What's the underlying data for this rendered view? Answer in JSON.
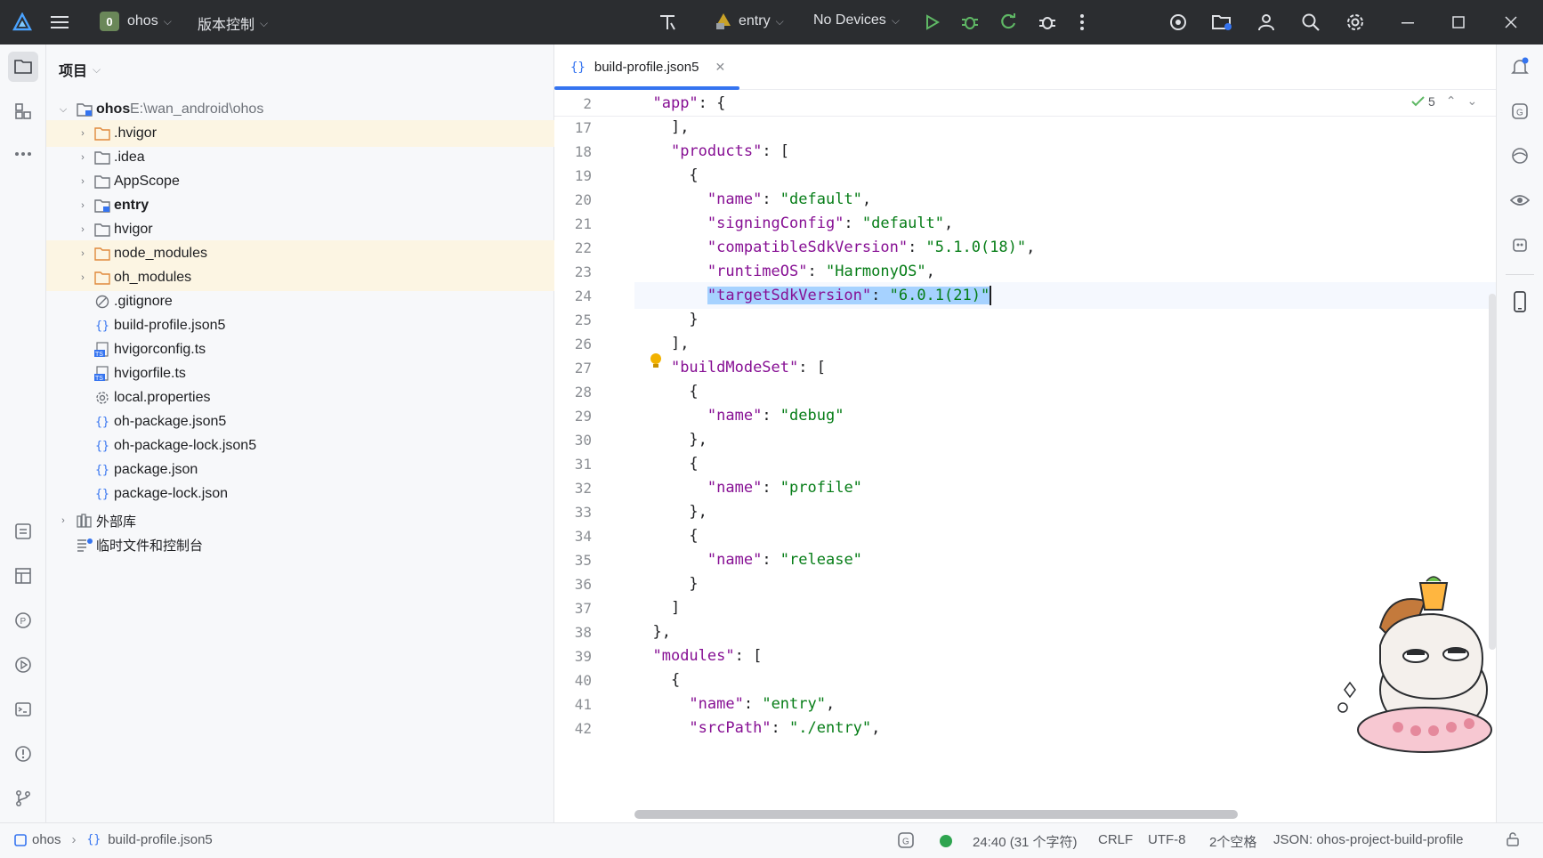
{
  "titlebar": {
    "project_badge": "0",
    "project_name": "ohos",
    "vcs_label": "版本控制",
    "module_name": "entry",
    "device_label": "No Devices"
  },
  "sidebar_panel": {
    "title": "项目"
  },
  "tree": {
    "root_name": "ohos",
    "root_path": "E:\\wan_android\\ohos",
    "items": [
      {
        "label": ".hvigor",
        "icon": "folder-icon"
      },
      {
        "label": ".idea",
        "icon": "folder-icon"
      },
      {
        "label": "AppScope",
        "icon": "folder-icon"
      },
      {
        "label": "entry",
        "icon": "module-folder-icon"
      },
      {
        "label": "hvigor",
        "icon": "folder-icon"
      },
      {
        "label": "node_modules",
        "icon": "folder-icon"
      },
      {
        "label": "oh_modules",
        "icon": "folder-icon"
      },
      {
        "label": ".gitignore",
        "icon": "ignore-file-icon"
      },
      {
        "label": "build-profile.json5",
        "icon": "json-icon"
      },
      {
        "label": "hvigorconfig.ts",
        "icon": "ts-file-icon"
      },
      {
        "label": "hvigorfile.ts",
        "icon": "ts-file-icon"
      },
      {
        "label": "local.properties",
        "icon": "properties-gear-icon"
      },
      {
        "label": "oh-package.json5",
        "icon": "json-icon"
      },
      {
        "label": "oh-package-lock.json5",
        "icon": "json-icon"
      },
      {
        "label": "package.json",
        "icon": "json-icon"
      },
      {
        "label": "package-lock.json",
        "icon": "json-icon"
      }
    ],
    "external_libs": "外部库",
    "scratches": "临时文件和控制台"
  },
  "editor": {
    "tab_label": "build-profile.json5",
    "inspection_count": "5",
    "sticky_line": {
      "num": "2",
      "key": "\"app\"",
      "rest": ": {"
    },
    "lines": [
      {
        "num": "17",
        "indent": "    ",
        "parts": [
          {
            "t": "p",
            "v": "],"
          }
        ]
      },
      {
        "num": "18",
        "indent": "    ",
        "parts": [
          {
            "t": "k",
            "v": "\"products\""
          },
          {
            "t": "p",
            "v": ": ["
          }
        ]
      },
      {
        "num": "19",
        "indent": "      ",
        "parts": [
          {
            "t": "p",
            "v": "{"
          }
        ]
      },
      {
        "num": "20",
        "indent": "        ",
        "parts": [
          {
            "t": "k",
            "v": "\"name\""
          },
          {
            "t": "p",
            "v": ": "
          },
          {
            "t": "s",
            "v": "\"default\""
          },
          {
            "t": "p",
            "v": ","
          }
        ]
      },
      {
        "num": "21",
        "indent": "        ",
        "parts": [
          {
            "t": "k",
            "v": "\"signingConfig\""
          },
          {
            "t": "p",
            "v": ": "
          },
          {
            "t": "s",
            "v": "\"default\""
          },
          {
            "t": "p",
            "v": ","
          }
        ]
      },
      {
        "num": "22",
        "indent": "        ",
        "parts": [
          {
            "t": "k",
            "v": "\"compatibleSdkVersion\""
          },
          {
            "t": "p",
            "v": ": "
          },
          {
            "t": "s",
            "v": "\"5.1.0(18)\""
          },
          {
            "t": "p",
            "v": ","
          }
        ]
      },
      {
        "num": "23",
        "indent": "        ",
        "parts": [
          {
            "t": "k",
            "v": "\"runtimeOS\""
          },
          {
            "t": "p",
            "v": ": "
          },
          {
            "t": "s",
            "v": "\"HarmonyOS\""
          },
          {
            "t": "p",
            "v": ","
          }
        ]
      },
      {
        "num": "24",
        "indent": "        ",
        "selected": true,
        "parts": [
          {
            "t": "k",
            "v": "\"targetSdkVersion\""
          },
          {
            "t": "p",
            "v": ": "
          },
          {
            "t": "s",
            "v": "\"6.0.1(21)\""
          }
        ]
      },
      {
        "num": "25",
        "indent": "      ",
        "parts": [
          {
            "t": "p",
            "v": "}"
          }
        ]
      },
      {
        "num": "26",
        "indent": "    ",
        "parts": [
          {
            "t": "p",
            "v": "],"
          }
        ]
      },
      {
        "num": "27",
        "indent": "    ",
        "parts": [
          {
            "t": "k",
            "v": "\"buildModeSet\""
          },
          {
            "t": "p",
            "v": ": ["
          }
        ]
      },
      {
        "num": "28",
        "indent": "      ",
        "parts": [
          {
            "t": "p",
            "v": "{"
          }
        ]
      },
      {
        "num": "29",
        "indent": "        ",
        "parts": [
          {
            "t": "k",
            "v": "\"name\""
          },
          {
            "t": "p",
            "v": ": "
          },
          {
            "t": "s",
            "v": "\"debug\""
          }
        ]
      },
      {
        "num": "30",
        "indent": "      ",
        "parts": [
          {
            "t": "p",
            "v": "},"
          }
        ]
      },
      {
        "num": "31",
        "indent": "      ",
        "parts": [
          {
            "t": "p",
            "v": "{"
          }
        ]
      },
      {
        "num": "32",
        "indent": "        ",
        "parts": [
          {
            "t": "k",
            "v": "\"name\""
          },
          {
            "t": "p",
            "v": ": "
          },
          {
            "t": "s",
            "v": "\"profile\""
          }
        ]
      },
      {
        "num": "33",
        "indent": "      ",
        "parts": [
          {
            "t": "p",
            "v": "},"
          }
        ]
      },
      {
        "num": "34",
        "indent": "      ",
        "parts": [
          {
            "t": "p",
            "v": "{"
          }
        ]
      },
      {
        "num": "35",
        "indent": "        ",
        "parts": [
          {
            "t": "k",
            "v": "\"name\""
          },
          {
            "t": "p",
            "v": ": "
          },
          {
            "t": "s",
            "v": "\"release\""
          }
        ]
      },
      {
        "num": "36",
        "indent": "      ",
        "parts": [
          {
            "t": "p",
            "v": "}"
          }
        ]
      },
      {
        "num": "37",
        "indent": "    ",
        "parts": [
          {
            "t": "p",
            "v": "]"
          }
        ]
      },
      {
        "num": "38",
        "indent": "  ",
        "parts": [
          {
            "t": "p",
            "v": "},"
          }
        ]
      },
      {
        "num": "39",
        "indent": "  ",
        "parts": [
          {
            "t": "k",
            "v": "\"modules\""
          },
          {
            "t": "p",
            "v": ": ["
          }
        ]
      },
      {
        "num": "40",
        "indent": "    ",
        "parts": [
          {
            "t": "p",
            "v": "{"
          }
        ]
      },
      {
        "num": "41",
        "indent": "      ",
        "parts": [
          {
            "t": "k",
            "v": "\"name\""
          },
          {
            "t": "p",
            "v": ": "
          },
          {
            "t": "s",
            "v": "\"entry\""
          },
          {
            "t": "p",
            "v": ","
          }
        ]
      },
      {
        "num": "42",
        "indent": "      ",
        "parts": [
          {
            "t": "k",
            "v": "\"srcPath\""
          },
          {
            "t": "p",
            "v": ": "
          },
          {
            "t": "s",
            "v": "\"./entry\""
          },
          {
            "t": "p",
            "v": ","
          }
        ]
      }
    ]
  },
  "statusbar": {
    "crumb_project": "ohos",
    "crumb_file": "build-profile.json5",
    "position": "24:40 (31 个字符)",
    "line_sep": "CRLF",
    "encoding": "UTF-8",
    "indent": "2个空格",
    "schema": "JSON: ohos-project-build-profile"
  },
  "colors": {
    "accent": "#3574f0",
    "key": "#871094",
    "string": "#067d17",
    "selection": "#a6d2ff",
    "excluded_bg": "#fcf5e3"
  }
}
